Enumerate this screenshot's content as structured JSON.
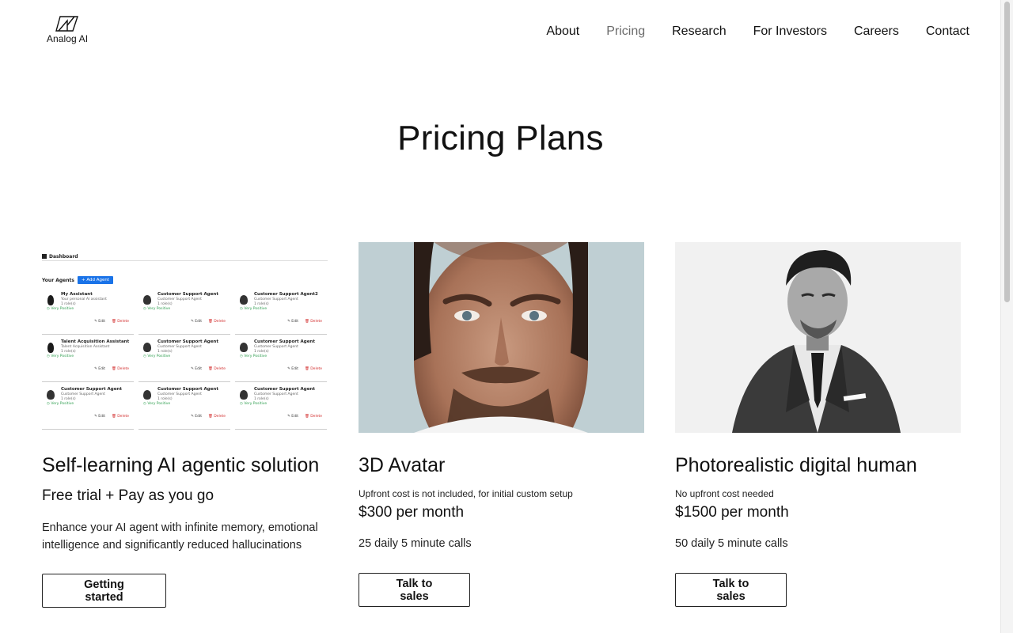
{
  "header": {
    "logo_text": "Analog AI",
    "nav": [
      {
        "label": "About",
        "active": false
      },
      {
        "label": "Pricing",
        "active": true
      },
      {
        "label": "Research",
        "active": false
      },
      {
        "label": "For Investors",
        "active": false
      },
      {
        "label": "Careers",
        "active": false
      },
      {
        "label": "Contact",
        "active": false
      }
    ]
  },
  "page": {
    "title": "Pricing Plans"
  },
  "plans": [
    {
      "title": "Self-learning AI agentic solution",
      "subtitle": "Free trial + Pay as you go",
      "description": "Enhance your AI agent with infinite memory, emotional intelligence and significantly reduced hallucinations",
      "button": "Getting started",
      "dashboard": {
        "header": "Dashboard",
        "agents_label": "Your Agents",
        "add_button": "+ Add Agent",
        "edit_label": "✎ Edit",
        "delete_label": "🗑 Delete",
        "tiles": [
          {
            "name": "My Assistant",
            "role": "Your personal AI assistant",
            "count": "1 role(s)",
            "rating": "◷ Very Positive"
          },
          {
            "name": "Customer Support Agent",
            "role": "Customer Support Agent",
            "count": "1 role(s)",
            "rating": "◷ Very Positive"
          },
          {
            "name": "Customer Support Agent2",
            "role": "Customer Support Agent",
            "count": "1 role(s)",
            "rating": "◷ Very Positive"
          },
          {
            "name": "Talent Acquisition Assistant",
            "role": "Talent Acquisition Assistant",
            "count": "1 role(s)",
            "rating": "◷ Very Positive"
          },
          {
            "name": "Customer Support Agent",
            "role": "Customer Support Agent",
            "count": "1 role(s)",
            "rating": "◷ Very Positive"
          },
          {
            "name": "Customer Support Agent",
            "role": "Customer Support Agent",
            "count": "1 role(s)",
            "rating": "◷ Very Positive"
          },
          {
            "name": "Customer Support Agent",
            "role": "Customer Support Agent",
            "count": "1 role(s)",
            "rating": "◷ Very Positive"
          },
          {
            "name": "Customer Support Agent",
            "role": "Customer Support Agent",
            "count": "1 role(s)",
            "rating": "◷ Very Positive"
          },
          {
            "name": "Customer Support Agent",
            "role": "Customer Support Agent",
            "count": "1 role(s)",
            "rating": "◷ Very Positive"
          }
        ]
      }
    },
    {
      "title": "3D Avatar",
      "note": "Upfront cost is not included, for initial custom setup",
      "price": "$300 per month",
      "calls": "25 daily 5 minute calls",
      "button": "Talk to sales"
    },
    {
      "title": "Photorealistic digital human",
      "note": "No upfront cost needed",
      "price": "$1500 per month",
      "calls": "50 daily 5 minute calls",
      "button": "Talk to sales"
    }
  ]
}
